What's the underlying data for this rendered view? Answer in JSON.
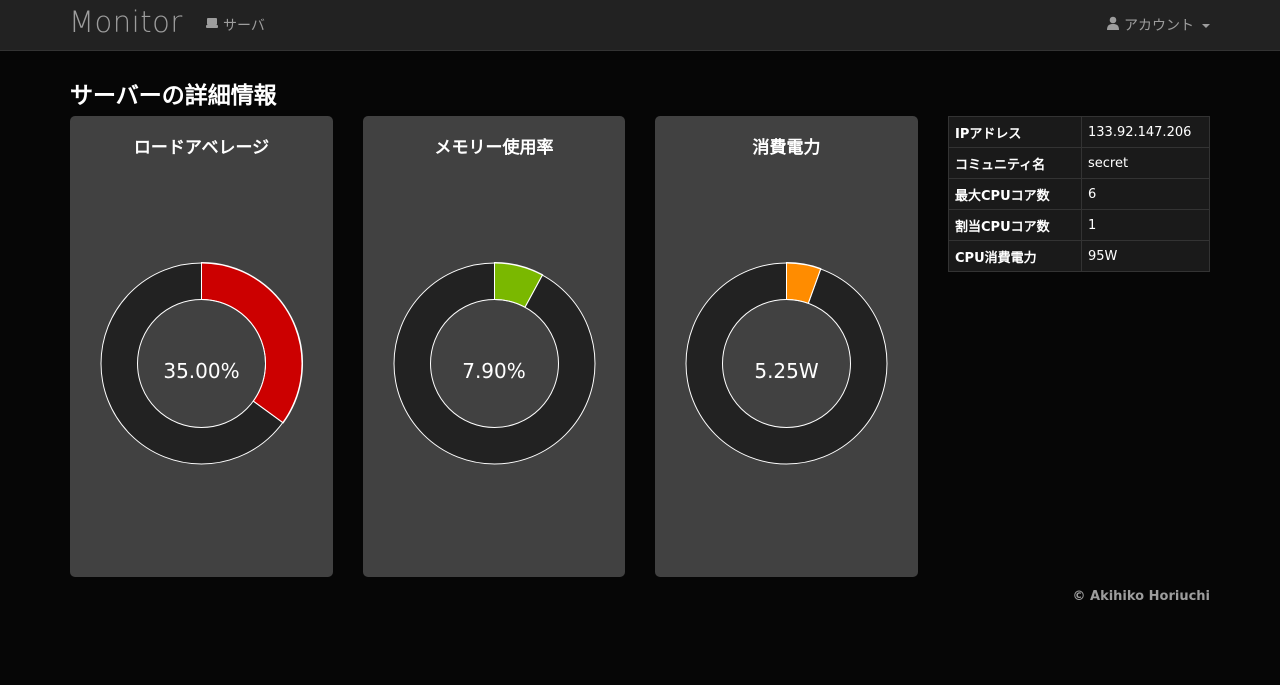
{
  "navbar": {
    "brand": "Monitor",
    "server_link": "サーバ",
    "account_label": "アカウント"
  },
  "page_title": "サーバーの詳細情報",
  "gauges": [
    {
      "title": "ロードアベレージ",
      "value_text": "35.00%",
      "fraction": 0.35,
      "color": "#cc0000"
    },
    {
      "title": "メモリー使用率",
      "value_text": "7.90%",
      "fraction": 0.079,
      "color": "#7ab800"
    },
    {
      "title": "消費電力",
      "value_text": "5.25W",
      "fraction": 0.0553,
      "color": "#ff8c00"
    }
  ],
  "info_table": [
    {
      "key": "IPアドレス",
      "value": "133.92.147.206"
    },
    {
      "key": "コミュニティ名",
      "value": "secret"
    },
    {
      "key": "最大CPUコア数",
      "value": "6"
    },
    {
      "key": "割当CPUコア数",
      "value": "1"
    },
    {
      "key": "CPU消費電力",
      "value": "95W"
    }
  ],
  "footer": "© Akihiko Horiuchi",
  "colors": {
    "ring_bg": "#222222",
    "panel_bg": "#414141",
    "nav_bg": "#222222"
  }
}
